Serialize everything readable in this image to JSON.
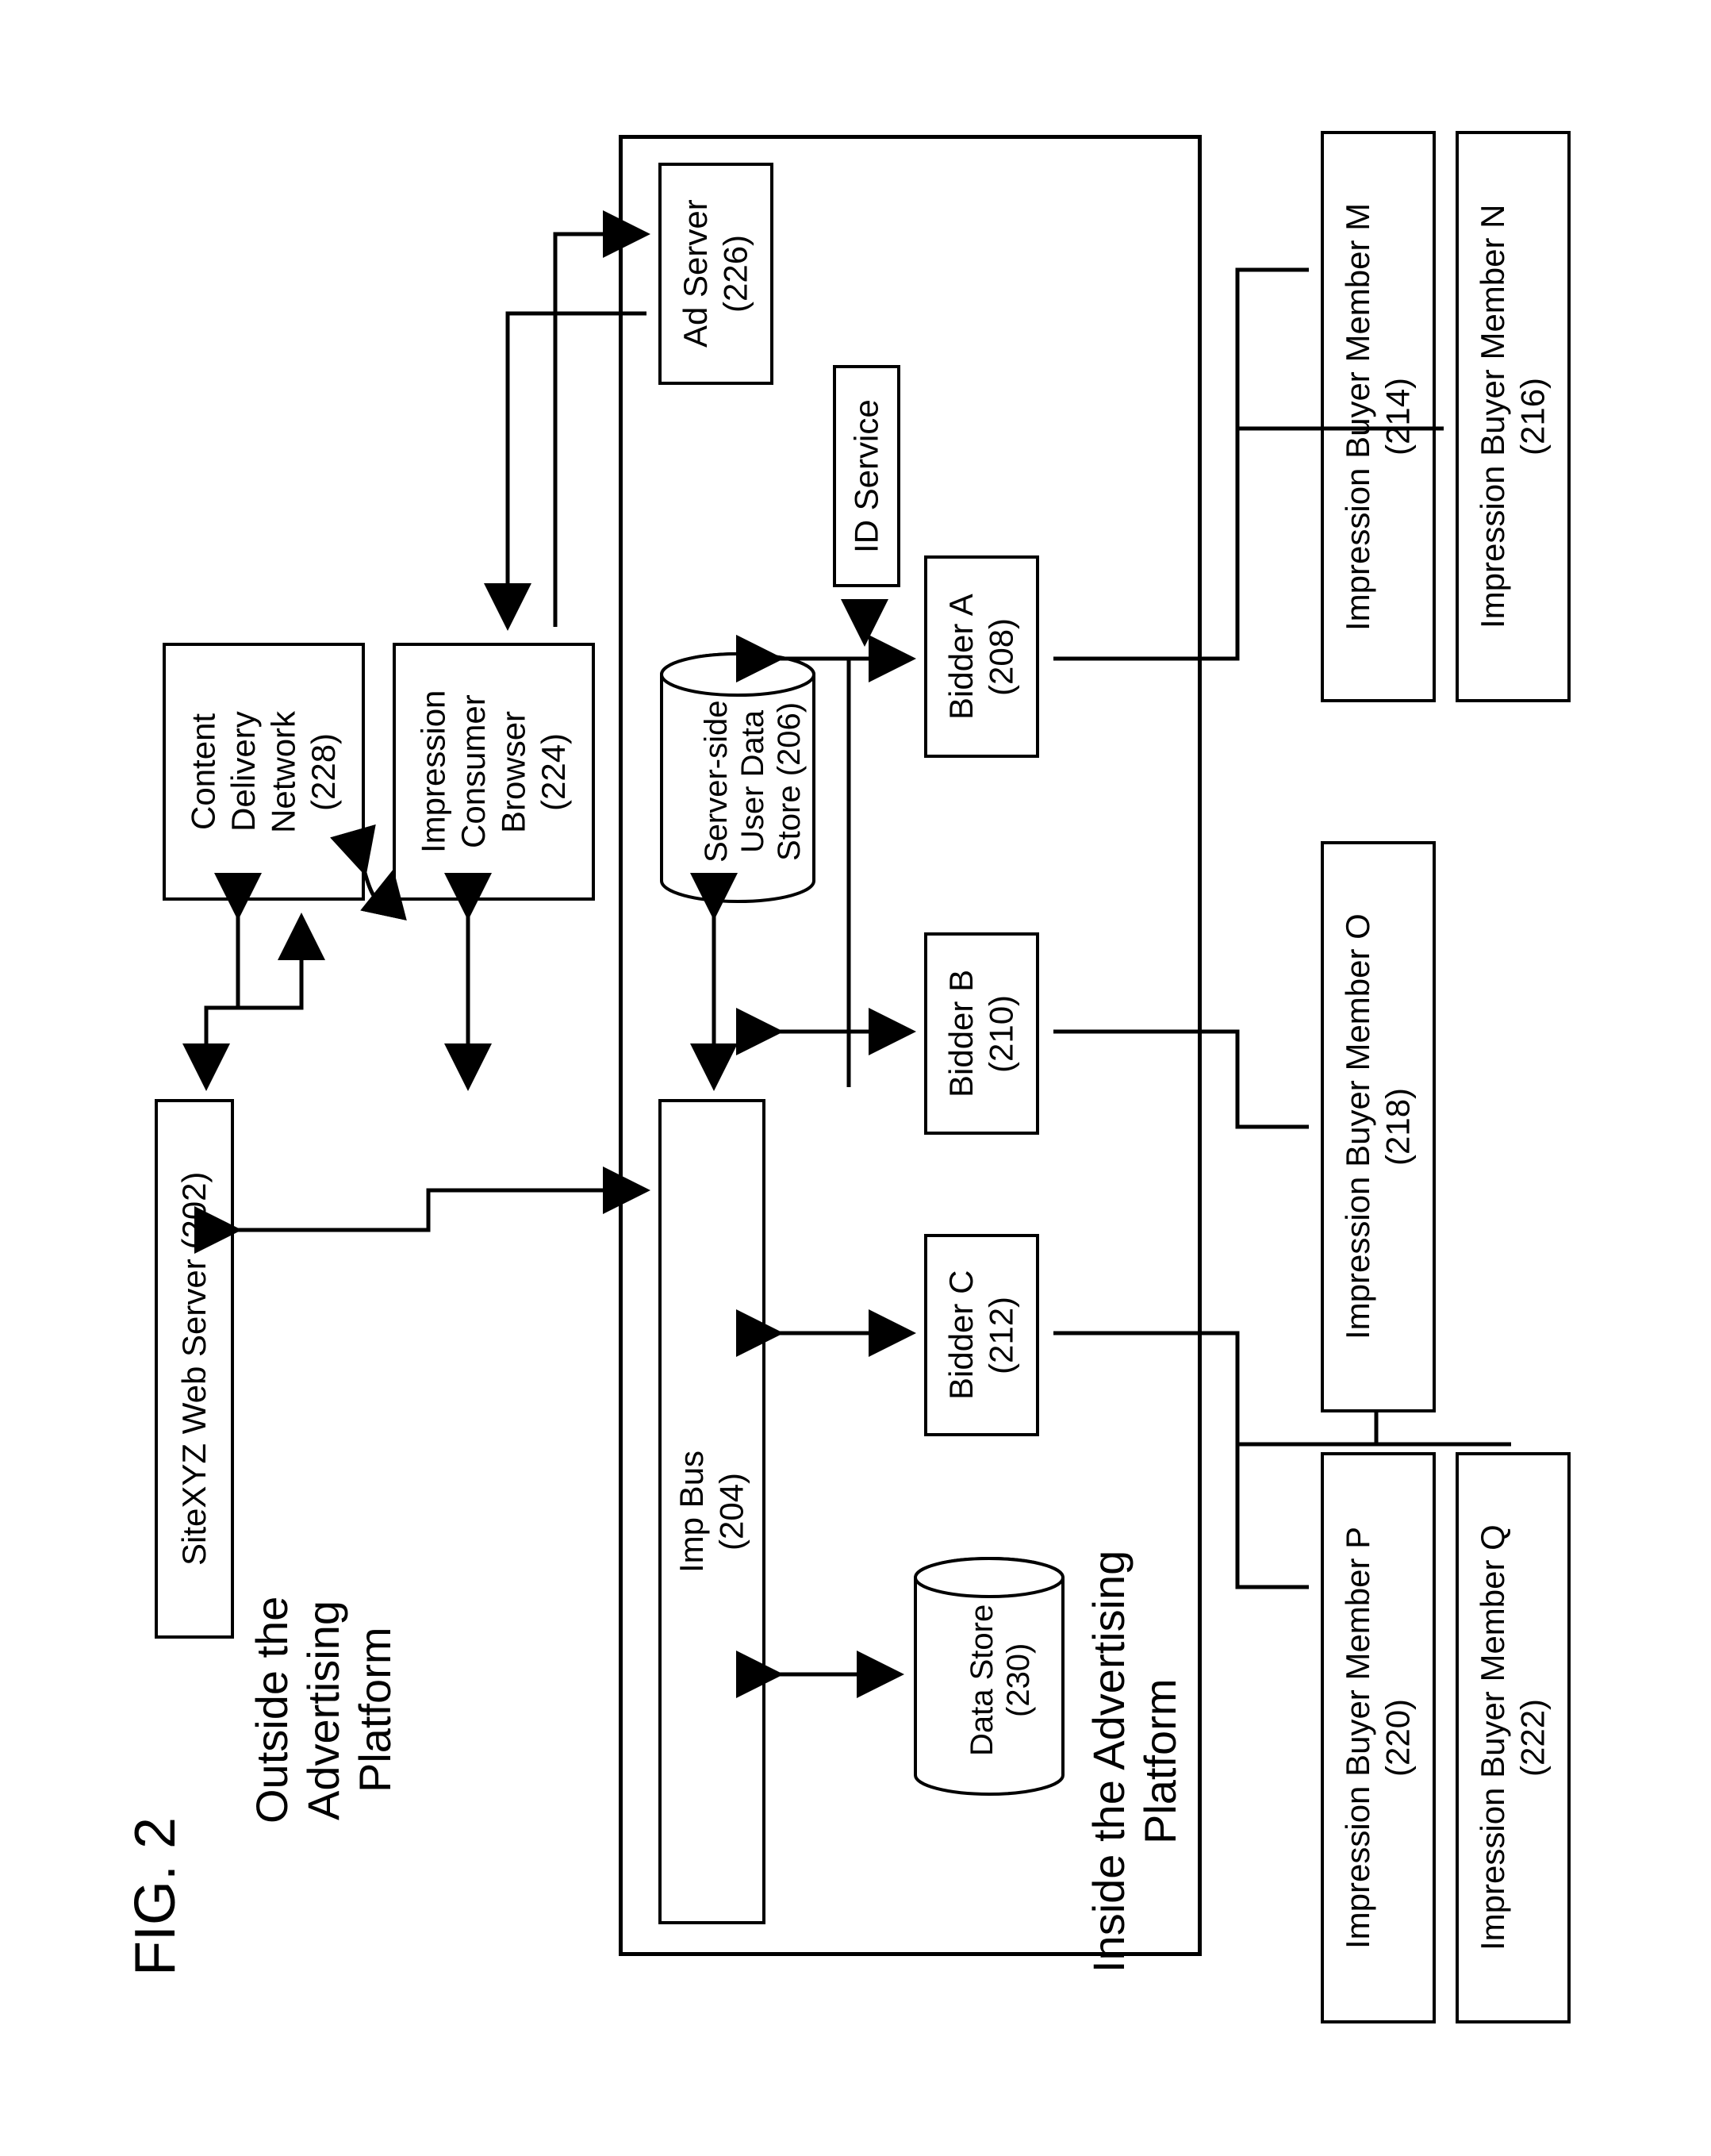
{
  "figure_label": "FIG. 2",
  "outside_label_l1": "Outside the",
  "outside_label_l2": "Advertising",
  "outside_label_l3": "Platform",
  "inside_label_l1": "Inside the Advertising",
  "inside_label_l2": "Platform",
  "boxes": {
    "cdn_l1": "Content",
    "cdn_l2": "Delivery",
    "cdn_l3": "Network",
    "cdn_l4": "(228)",
    "browser_l1": "Impression",
    "browser_l2": "Consumer",
    "browser_l3": "Browser",
    "browser_l4": "(224)",
    "webserver": "SiteXYZ Web Server (202)",
    "adserver_l1": "Ad Server",
    "adserver_l2": "(226)",
    "idservice": "ID Service",
    "userdata_l1": "Server-side",
    "userdata_l2": "User Data",
    "userdata_l3": "Store (206)",
    "impbus_l1": "Imp Bus",
    "impbus_l2": "(204)",
    "bidderA_l1": "Bidder A",
    "bidderA_l2": "(208)",
    "bidderB_l1": "Bidder B",
    "bidderB_l2": "(210)",
    "bidderC_l1": "Bidder C",
    "bidderC_l2": "(212)",
    "datastore_l1": "Data Store",
    "datastore_l2": "(230)",
    "buyerM_l1": "Impression Buyer Member M",
    "buyerM_l2": "(214)",
    "buyerN_l1": "Impression Buyer Member N",
    "buyerN_l2": "(216)",
    "buyerO_l1": "Impression Buyer Member O",
    "buyerO_l2": "(218)",
    "buyerP_l1": "Impression Buyer Member P",
    "buyerP_l2": "(220)",
    "buyerQ_l1": "Impression Buyer Member Q",
    "buyerQ_l2": "(222)"
  }
}
